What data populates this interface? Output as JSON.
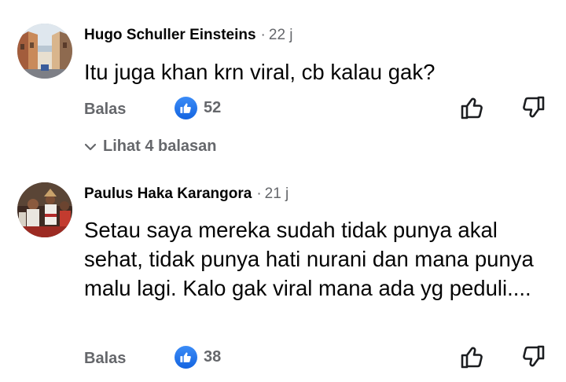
{
  "comments": [
    {
      "author": "Hugo Schuller Einsteins",
      "time": "22 j",
      "text": "Itu juga khan krn viral, cb kalau gak?",
      "reply_label": "Balas",
      "like_count": "52",
      "view_replies_label": "Lihat 4 balasan"
    },
    {
      "author": "Paulus Haka Karangora",
      "time": "21 j",
      "text": "Setau saya mereka sudah tidak punya akal sehat, tidak punya hati nurani dan mana punya malu lagi. Kalo gak viral mana ada yg peduli....",
      "reply_label": "Balas",
      "like_count": "38"
    }
  ],
  "separator": "·",
  "icons": {
    "like_badge": "thumbs-up-icon",
    "like_action": "thumb-up-outline-icon",
    "dislike_action": "thumb-down-outline-icon",
    "expand": "chevron-down-icon"
  },
  "colors": {
    "like_badge": "#1877f2",
    "secondary_text": "#65676b",
    "primary_text": "#050505"
  }
}
